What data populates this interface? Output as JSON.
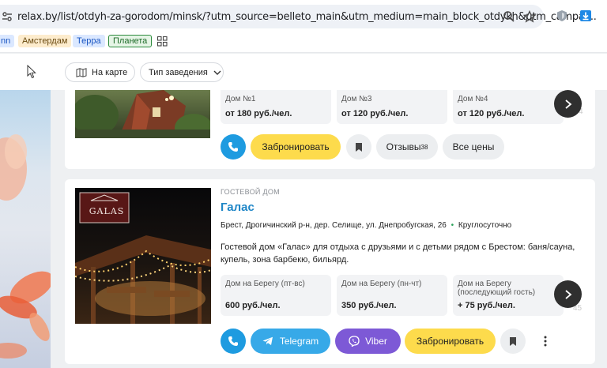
{
  "browser": {
    "url": "relax.by/list/otdyh-za-gorodom/minsk/?utm_source=belleto_main&utm_medium=main_block_otdykh&utm_campai..."
  },
  "bookmarks": [
    {
      "label": "nn",
      "bg": "#dbe8ff",
      "color": "#1a56c2"
    },
    {
      "label": "Амстердам",
      "bg": "#fdeccd",
      "color": "#6a4a10"
    },
    {
      "label": "Терра",
      "bg": "#dbe8ff",
      "color": "#1a56c2"
    },
    {
      "label": "Планета",
      "bg": "#e6f5e6",
      "color": "#1d6b28"
    }
  ],
  "filters": {
    "map_label": "На карте",
    "type_label": "Тип заведения"
  },
  "card1": {
    "prices": [
      {
        "name": "Дом №1",
        "price": "от 180 руб./чел."
      },
      {
        "name": "Дом №3",
        "price": "от 120 руб./чел."
      },
      {
        "name": "Дом №4",
        "price": "от 120 руб./чел."
      }
    ],
    "ghost_count": "4",
    "book_label": "Забронировать",
    "reviews_label": "Отзывы",
    "reviews_count": "38",
    "all_prices_label": "Все цены"
  },
  "card2": {
    "category": "ГОСТЕВОЙ ДОМ",
    "logo_text": "GALAS",
    "title": "Галас",
    "address": "Брест, Дрогичинский р-н, дер. Селище, ул. Днепробугская, 26",
    "hours": "Круглосуточно",
    "description": "Гостевой дом «Галас» для отдыха с друзьями и с детьми рядом с Брестом: баня/сауна, купель, зона барбекю, бильярд.",
    "prices": [
      {
        "name": "Дом на Берегу (пт-вс)",
        "price": "600 руб./чел."
      },
      {
        "name": "Дом на Берегу (пн-чт)",
        "price": "350 руб./чел."
      },
      {
        "name": "Дом на Берегу (последующий гость)",
        "price": "+ 75 руб./чел."
      }
    ],
    "ghost_count": "45",
    "telegram_label": "Telegram",
    "viber_label": "Viber",
    "book_label": "Забронировать"
  },
  "colors": {
    "accent_blue": "#1e9be0",
    "book_yellow": "#fddb4c",
    "telegram": "#37a9e8",
    "viber": "#7d59d6",
    "title_blue": "#1f86c7",
    "hours_green": "#2aa25a"
  }
}
